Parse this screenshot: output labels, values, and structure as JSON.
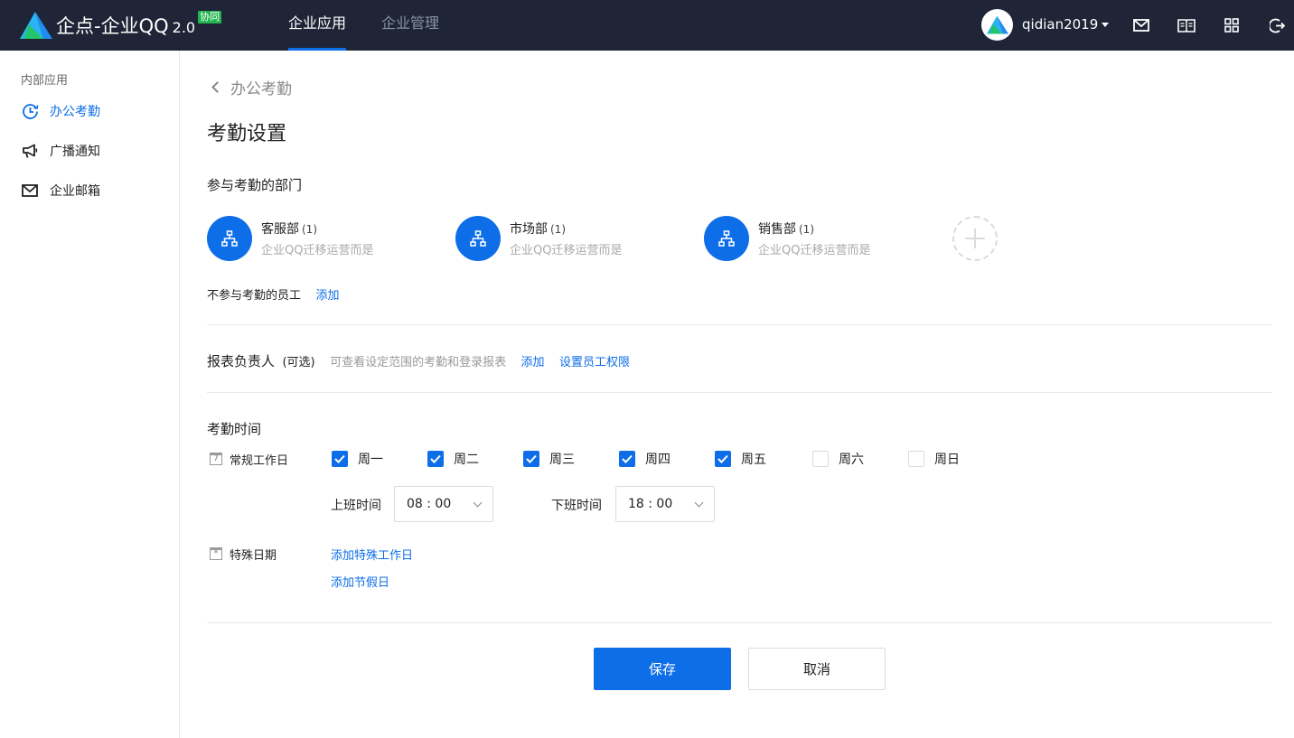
{
  "brand": {
    "name": "企点-企业QQ",
    "version": "2.0",
    "badge": "协同",
    "logo_icon": "qidian-logo-icon"
  },
  "nav": {
    "tabs": [
      {
        "label": "企业应用",
        "active": true
      },
      {
        "label": "企业管理",
        "active": false
      }
    ]
  },
  "user": {
    "name": "qidian2019",
    "icons": [
      "mail-icon",
      "book-icon",
      "apps-grid-icon",
      "logout-icon"
    ]
  },
  "sidebar": {
    "title": "内部应用",
    "items": [
      {
        "label": "办公考勤",
        "icon": "clock-icon",
        "active": true
      },
      {
        "label": "广播通知",
        "icon": "megaphone-icon",
        "active": false
      },
      {
        "label": "企业邮箱",
        "icon": "mail-icon",
        "active": false
      }
    ]
  },
  "main": {
    "back_label": "办公考勤",
    "title": "考勤设置",
    "departments_label": "参与考勤的部门",
    "departments": [
      {
        "name": "客服部",
        "count": "(1)",
        "sub": "企业QQ迁移运营而是"
      },
      {
        "name": "市场部",
        "count": "(1)",
        "sub": "企业QQ迁移运营而是"
      },
      {
        "name": "销售部",
        "count": "(1)",
        "sub": "企业QQ迁移运营而是"
      }
    ],
    "excluded_label": "不参与考勤的员工",
    "excluded_add": "添加",
    "report": {
      "label": "报表负责人",
      "optional": "(可选)",
      "hint": "可查看设定范围的考勤和登录报表",
      "add": "添加",
      "permission_link": "设置员工权限"
    },
    "time_label": "考勤时间",
    "workdays_label": "常规工作日",
    "workday_icon_text": "7",
    "days": [
      {
        "label": "周一",
        "checked": true
      },
      {
        "label": "周二",
        "checked": true
      },
      {
        "label": "周三",
        "checked": true
      },
      {
        "label": "周四",
        "checked": true
      },
      {
        "label": "周五",
        "checked": true
      },
      {
        "label": "周六",
        "checked": false
      },
      {
        "label": "周日",
        "checked": false
      }
    ],
    "start": {
      "label": "上班时间",
      "value": "08 : 00"
    },
    "end": {
      "label": "下班时间",
      "value": "18 : 00"
    },
    "special_label": "特殊日期",
    "special_icon_text": "*",
    "add_special_workday": "添加特殊工作日",
    "add_holiday": "添加节假日",
    "save": "保存",
    "cancel": "取消"
  },
  "colors": {
    "accent": "#0d6ee8",
    "topbar": "#1f2536",
    "badge": "#23b34f"
  }
}
